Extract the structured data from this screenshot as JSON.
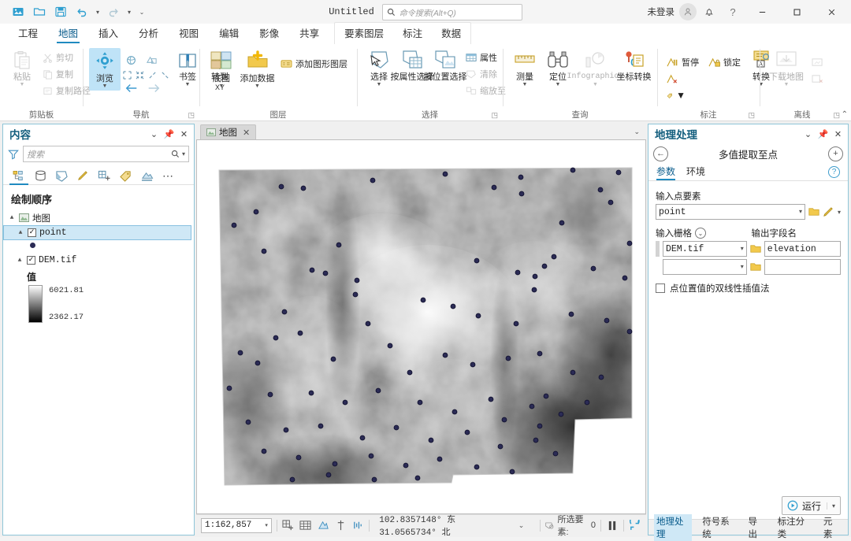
{
  "window": {
    "doc_title": "Untitled",
    "search_placeholder": "命令搜索(Alt+Q)",
    "signin_label": "未登录",
    "minimize": "—",
    "maximize": "□",
    "close": "✕"
  },
  "ribbon": {
    "tabs": [
      {
        "label": "工程",
        "active": false
      },
      {
        "label": "地图",
        "active": true
      },
      {
        "label": "插入",
        "active": false
      },
      {
        "label": "分析",
        "active": false
      },
      {
        "label": "视图",
        "active": false
      },
      {
        "label": "编辑",
        "active": false
      },
      {
        "label": "影像",
        "active": false
      },
      {
        "label": "共享",
        "active": false
      }
    ],
    "context_tabs": [
      {
        "label": "要素图层",
        "active": false
      },
      {
        "label": "标注",
        "active": false
      },
      {
        "label": "数据",
        "active": false
      }
    ],
    "groups": [
      {
        "name": "剪贴板",
        "paste": "粘贴",
        "cut": "剪切",
        "copy": "复制",
        "copy_path": "复制路径"
      },
      {
        "name": "导航",
        "explore": "浏览",
        "bookmarks": "书签",
        "goto_xy": "转到",
        "goto_xy2": "XY"
      },
      {
        "name": "图层",
        "basemap": "底图",
        "add_data": "添加数据",
        "add_graphics_layer": "添加图形图层"
      },
      {
        "name": "选择",
        "select": "选择",
        "select_by_attribute": "按属性选择",
        "select_by_location": "按位置选择",
        "attributes": "属性",
        "clear": "清除",
        "zoom_to": "缩放至"
      },
      {
        "name": "查询",
        "measure": "测量",
        "locate": "定位",
        "infographics": "Infographics",
        "coord_convert": "坐标转换"
      },
      {
        "name": "标注",
        "pause": "暂停",
        "lock": "锁定",
        "convert": "转换"
      },
      {
        "name": "离线",
        "download_map": "下载地图"
      }
    ]
  },
  "contents": {
    "title": "内容",
    "search_placeholder": "搜索",
    "drawing_order": "绘制顺序",
    "tree": [
      {
        "label": "地图",
        "type": "map",
        "indent": 0,
        "checked": null,
        "expanded": true,
        "selected": false
      },
      {
        "label": "point",
        "type": "layer",
        "indent": 1,
        "checked": true,
        "expanded": true,
        "selected": true
      },
      {
        "label": "DEM.tif",
        "type": "raster",
        "indent": 1,
        "checked": true,
        "expanded": true,
        "selected": false
      }
    ],
    "legend": {
      "value_label": "值",
      "max": "6021.81",
      "min": "2362.17"
    }
  },
  "map": {
    "tab_label": "地图",
    "tab_close": "✕"
  },
  "status": {
    "scale": "1:162,857",
    "coordinates": "102.8357148° 东  31.0565734° 北",
    "selected_features_label": "所选要素:",
    "selected_features_count": "0"
  },
  "geoprocessing": {
    "title": "地理处理",
    "tool_title": "多值提取至点",
    "tabs": [
      {
        "label": "参数",
        "active": true
      },
      {
        "label": "环境",
        "active": false
      }
    ],
    "help_icon": "?",
    "fields": {
      "input_point_features_label": "输入点要素",
      "input_point_features_value": "point",
      "input_rasters_label": "输入栅格",
      "output_field_name_label": "输出字段名",
      "raster_rows": [
        {
          "raster": "DEM.tif",
          "field": "elevation"
        },
        {
          "raster": "",
          "field": ""
        }
      ],
      "bilinear_checkbox_label": "点位置值的双线性插值法",
      "bilinear_checked": false
    },
    "run_label": "运行",
    "bottom_tabs": [
      {
        "label": "地理处理",
        "active": true
      },
      {
        "label": "符号系统",
        "active": false
      },
      {
        "label": "导出",
        "active": false
      },
      {
        "label": "标注分类",
        "active": false
      },
      {
        "label": "元素",
        "active": false
      }
    ]
  },
  "colors": {
    "accent": "#1f8ac0",
    "pane_border": "#8ec5d8",
    "point_fill": "#2b2b55",
    "selection": "#cfe8f6"
  }
}
